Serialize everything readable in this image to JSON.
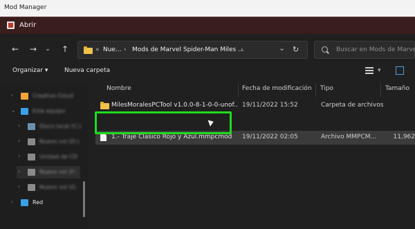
{
  "window": {
    "title": "Mod Manager"
  },
  "dialog": {
    "title": "Abrir"
  },
  "navigation": {
    "back_icon": "arrow-left-icon",
    "forward_icon": "arrow-right-icon",
    "recent_icon": "chevron-down-icon",
    "up_icon": "arrow-up-icon",
    "refresh_icon": "refresh-icon"
  },
  "address": {
    "prefix": "«",
    "crumbs": [
      "Nue...",
      "Mods de Marvel Spider-Man Miles ..."
    ],
    "separator": "›",
    "dropdown": "⌄"
  },
  "search": {
    "placeholder": "Buscar en Mods de Marvel S"
  },
  "toolbar": {
    "organize_label": "Organizar",
    "organize_caret": "▾",
    "new_folder_label": "Nueva carpeta"
  },
  "columns": {
    "name": "Nombre",
    "modified": "Fecha de modificación",
    "type": "Tipo",
    "size": "Tamaño"
  },
  "files": [
    {
      "name": "MilesMoralesPCTool v1.0.0-8-1-0-0-unof...",
      "modified": "19/11/2022 15:52",
      "type": "Carpeta de archivos",
      "size": "",
      "icon": "folder-icon"
    },
    {
      "name": "1.- Traje Clasico Rojo y Azul.mmpcmod",
      "modified": "19/11/2022 02:05",
      "type": "Archivo MMPCM...",
      "size": "11,962",
      "icon": "file-icon"
    }
  ],
  "sidebar": {
    "items": [
      {
        "label": "Creative Cloud",
        "icon": "cloud-icon",
        "color": "#f2a33a"
      },
      {
        "label": "Este equipo",
        "icon": "computer-icon",
        "color": "#3aa0e8"
      },
      {
        "label": "Disco local (C:)",
        "icon": "drive-icon",
        "color": "#6b8fb0"
      },
      {
        "label": "Nuevo vol (D:)",
        "icon": "drive-icon",
        "color": "#8a8a8a"
      },
      {
        "label": "Unidad de CD",
        "icon": "drive-icon",
        "color": "#8a8a8a"
      },
      {
        "label": "Nuevo vol (F:)",
        "icon": "drive-icon",
        "color": "#8a8a8a"
      },
      {
        "label": "Nuevo vol (G:)",
        "icon": "drive-icon",
        "color": "#8a8a8a"
      },
      {
        "label": "Red",
        "icon": "network-icon",
        "color": "#3aa0e8"
      }
    ]
  },
  "colors": {
    "titlebar": "#3a1d1d",
    "highlight_box": "#1fdc1f",
    "folder": "#f0c24b"
  }
}
